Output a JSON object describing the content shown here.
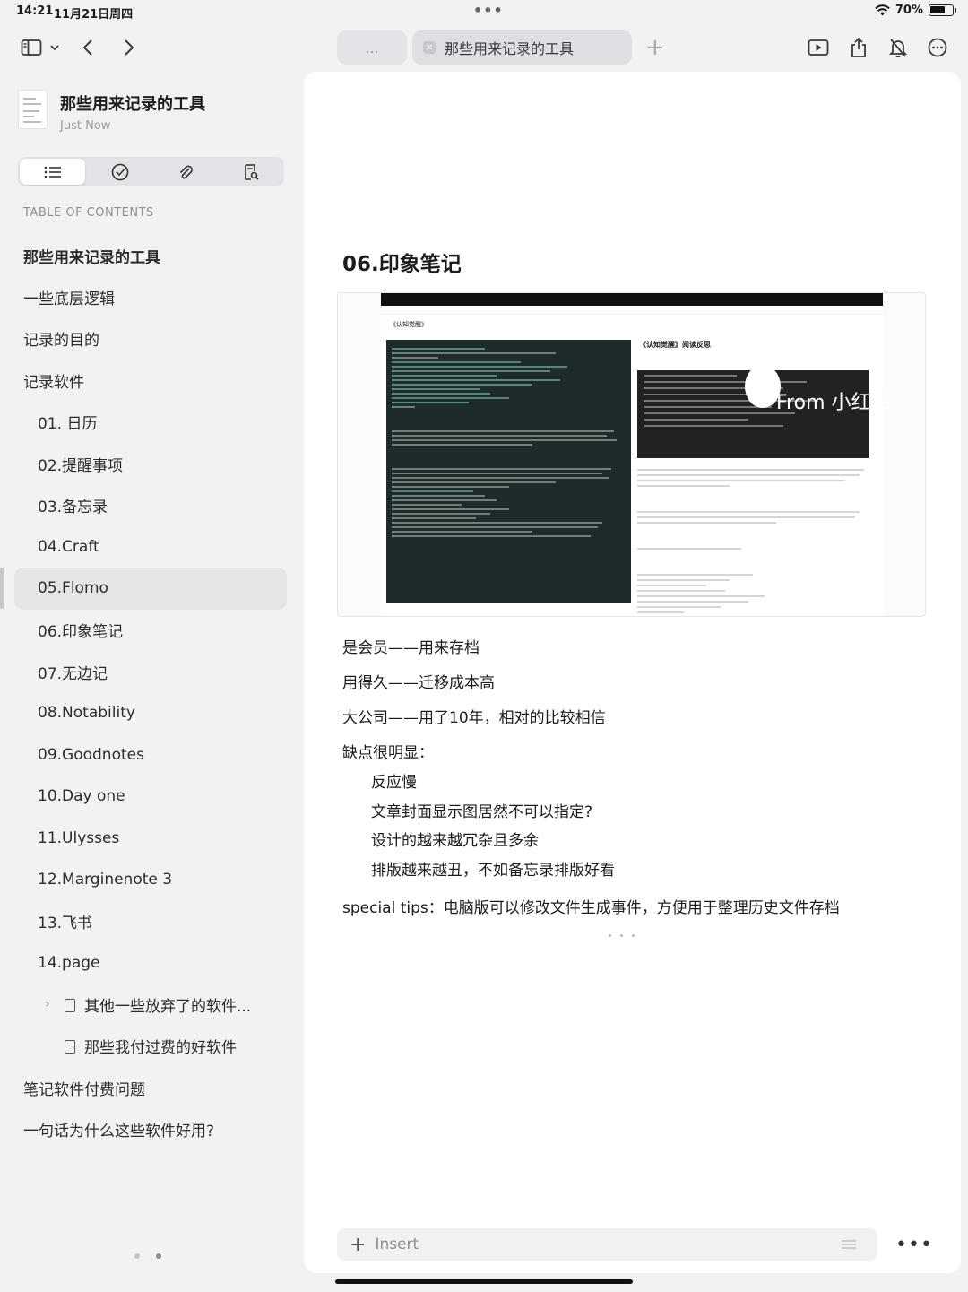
{
  "status_bar": {
    "time": "14:21",
    "date": "11月21日周四",
    "center_dots": "•••",
    "battery": "70%",
    "battery_level": 0.7
  },
  "toolbar": {
    "tab_ghost": "...",
    "active_tab": "那些用来记录的工具"
  },
  "sidebar": {
    "doc_title": "那些用来记录的工具",
    "doc_subtitle": "Just Now",
    "toc_label": "TABLE OF CONTENTS",
    "toc": [
      {
        "label": "那些用来记录的工具"
      },
      {
        "label": "一些底层逻辑"
      },
      {
        "label": "记录的目的"
      },
      {
        "label": "记录软件"
      },
      {
        "label": "01. 日历"
      },
      {
        "label": "02.提醒事项"
      },
      {
        "label": "03.备忘录"
      },
      {
        "label": "04.Craft"
      },
      {
        "label": "05.Flomo"
      },
      {
        "label": "06.印象笔记"
      },
      {
        "label": "07.无边记"
      },
      {
        "label": "08.Notability"
      },
      {
        "label": "09.Goodnotes"
      },
      {
        "label": "10.Day one"
      },
      {
        "label": "11.Ulysses"
      },
      {
        "label": "12.Marginenote 3"
      },
      {
        "label": "13.飞书"
      },
      {
        "label": "14.page"
      },
      {
        "label": "其他一些放弃了的软件..."
      },
      {
        "label": "那些我付过费的好软件"
      },
      {
        "label": "笔记软件付费问题"
      },
      {
        "label": "一句话为什么这些软件好用?"
      }
    ]
  },
  "document": {
    "heading": "06.印象笔记",
    "image": {
      "note_label": "《认知觉醒》",
      "right_title": "《认知觉醒》阅读反思",
      "watermark": "From 小红书"
    },
    "paragraphs": [
      "是会员——用来存档",
      "用得久——迁移成本高",
      "大公司——用了10年，相对的比较相信",
      "缺点很明显："
    ],
    "cons": [
      "反应慢",
      "文章封面显示图居然不可以指定?",
      "设计的越来越冗杂且多余",
      "排版越来越丑，不如备忘录排版好看"
    ],
    "tips": "special tips：电脑版可以修改文件生成事件，方便用于整理历史文件存档",
    "insert_placeholder": "Insert"
  }
}
